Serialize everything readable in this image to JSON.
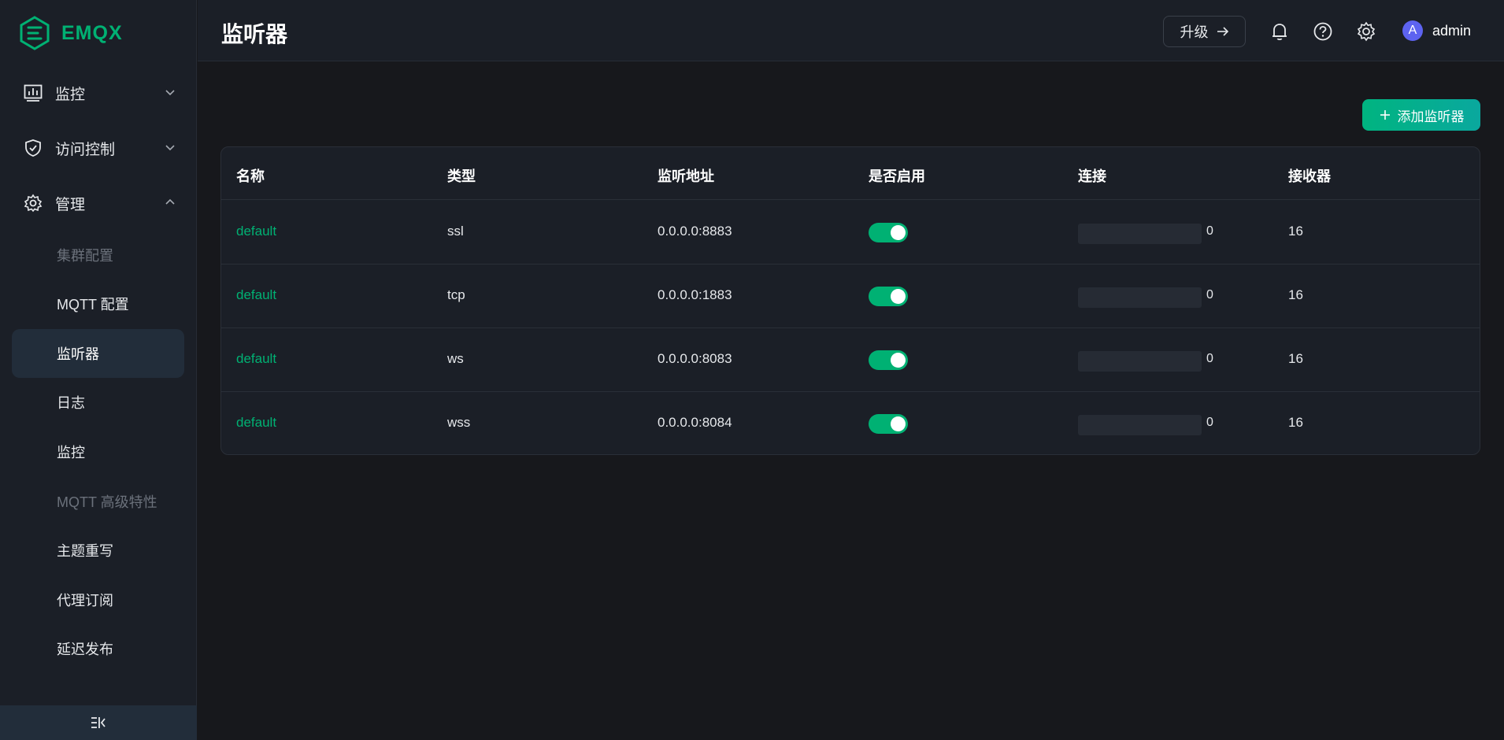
{
  "brand": {
    "name": "EMQX",
    "color": "#00b173"
  },
  "sidebar": {
    "menus": [
      {
        "label": "监控",
        "icon": "dashboard-icon",
        "expanded": false
      },
      {
        "label": "访问控制",
        "icon": "shield-icon",
        "expanded": false
      },
      {
        "label": "管理",
        "icon": "gear-icon",
        "expanded": true
      }
    ],
    "sub_items": [
      {
        "label": "集群配置",
        "disabled": true
      },
      {
        "label": "MQTT 配置"
      },
      {
        "label": "监听器",
        "active": true
      },
      {
        "label": "日志"
      },
      {
        "label": "监控"
      },
      {
        "label": "MQTT 高级特性",
        "disabled": true
      },
      {
        "label": "主题重写"
      },
      {
        "label": "代理订阅"
      },
      {
        "label": "延迟发布"
      }
    ],
    "collapse_icon": "collapse-sidebar-icon"
  },
  "header": {
    "title": "监听器",
    "upgrade_label": "升级",
    "icons": [
      "bell-icon",
      "help-icon",
      "settings-icon"
    ],
    "user": {
      "initial": "A",
      "name": "admin"
    }
  },
  "main": {
    "add_button_label": "添加监听器",
    "table": {
      "columns": [
        "名称",
        "类型",
        "监听地址",
        "是否启用",
        "连接",
        "接收器"
      ],
      "rows": [
        {
          "name": "default",
          "type": "ssl",
          "address": "0.0.0.0:8883",
          "enabled": true,
          "connections": "0",
          "connections_fraction": 0,
          "acceptors": "16"
        },
        {
          "name": "default",
          "type": "tcp",
          "address": "0.0.0.0:1883",
          "enabled": true,
          "connections": "0",
          "connections_fraction": 0,
          "acceptors": "16"
        },
        {
          "name": "default",
          "type": "ws",
          "address": "0.0.0.0:8083",
          "enabled": true,
          "connections": "0",
          "connections_fraction": 0,
          "acceptors": "16"
        },
        {
          "name": "default",
          "type": "wss",
          "address": "0.0.0.0:8084",
          "enabled": true,
          "connections": "0",
          "connections_fraction": 0,
          "acceptors": "16"
        }
      ]
    }
  }
}
